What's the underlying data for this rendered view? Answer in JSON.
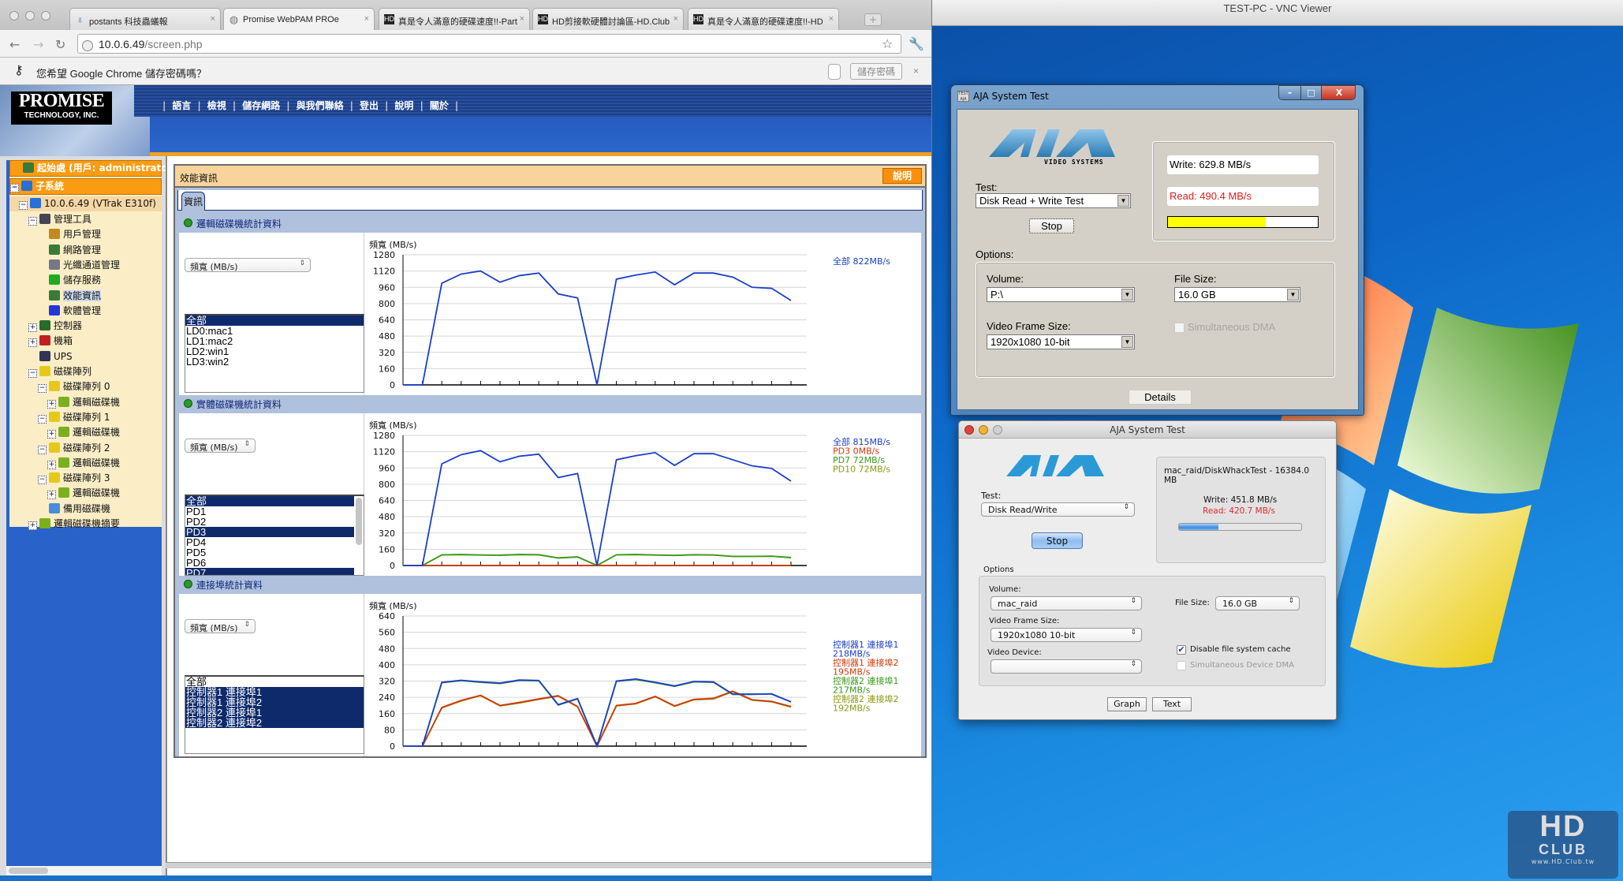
{
  "browser": {
    "tabs": [
      {
        "label": "postants 科技蟲蟻報",
        "favicon": "postants-icon"
      },
      {
        "label": "Promise WebPAM PROe",
        "favicon": "globe-icon",
        "active": true
      },
      {
        "label": "真是令人滿意的硬碟速度!!-Part",
        "favicon": "hd-icon"
      },
      {
        "label": "HD剪接軟硬體討論區-HD.Club",
        "favicon": "hd-icon"
      },
      {
        "label": "真是令人滿意的硬碟速度!!-HD",
        "favicon": "hd-icon"
      }
    ],
    "url_host": "10.0.6.49",
    "url_path": "/screen.php",
    "infobar_message": "您希望 Google Chrome 儲存密碼嗎？",
    "infobar_save": "儲存密碼",
    "infobar_close": "×"
  },
  "promise": {
    "logo_main": "PROMISE",
    "logo_sub": "TECHNOLOGY, INC.",
    "nav": [
      "語言",
      "檢視",
      "儲存網路",
      "與我們聯絡",
      "登出",
      "說明",
      "關於"
    ],
    "tree": [
      {
        "label": "起始處 (用戶: administrator)",
        "level": 0,
        "type": "header",
        "icon": "network-icon"
      },
      {
        "label": "子系統",
        "level": 0,
        "type": "header",
        "icon": "subsystem-icon",
        "toggle": "-"
      },
      {
        "label": "10.0.6.49 (VTrak E310f)",
        "level": 1,
        "type": "sub",
        "icon": "server-icon",
        "toggle": "-"
      },
      {
        "label": "管理工具",
        "level": 2,
        "icon": "admin-tools-icon",
        "toggle": "-"
      },
      {
        "label": "用戶管理",
        "level": 3,
        "icon": "user-icon"
      },
      {
        "label": "網路管理",
        "level": 3,
        "icon": "network-icon"
      },
      {
        "label": "光纖通道管理",
        "level": 3,
        "icon": "fibre-channel-icon"
      },
      {
        "label": "儲存服務",
        "level": 3,
        "icon": "storage-service-icon"
      },
      {
        "label": "效能資訊",
        "level": 3,
        "icon": "network-icon",
        "selected": true
      },
      {
        "label": "軟體管理",
        "level": 3,
        "icon": "software-gear-icon"
      },
      {
        "label": "控制器",
        "level": 2,
        "icon": "controller-icon",
        "toggle": "+"
      },
      {
        "label": "機箱",
        "level": 2,
        "icon": "enclosure-icon",
        "toggle": "+"
      },
      {
        "label": "UPS",
        "level": 2,
        "icon": "ups-icon"
      },
      {
        "label": "磁碟陣列",
        "level": 2,
        "icon": "disk-array-icon",
        "toggle": "-"
      },
      {
        "label": "磁碟陣列 0",
        "level": 3,
        "icon": "disk-array-icon",
        "toggle": "-"
      },
      {
        "label": "邏輯磁碟機",
        "level": 4,
        "icon": "logical-drive-icon",
        "toggle": "+"
      },
      {
        "label": "磁碟陣列 1",
        "level": 3,
        "icon": "disk-array-icon",
        "toggle": "-"
      },
      {
        "label": "邏輯磁碟機",
        "level": 4,
        "icon": "logical-drive-icon",
        "toggle": "+"
      },
      {
        "label": "磁碟陣列 2",
        "level": 3,
        "icon": "disk-array-icon",
        "toggle": "-"
      },
      {
        "label": "邏輯磁碟機",
        "level": 4,
        "icon": "logical-drive-icon",
        "toggle": "+"
      },
      {
        "label": "磁碟陣列 3",
        "level": 3,
        "icon": "disk-array-icon",
        "toggle": "-"
      },
      {
        "label": "邏輯磁碟機",
        "level": 4,
        "icon": "logical-drive-icon",
        "toggle": "+"
      },
      {
        "label": "備用磁碟機",
        "level": 3,
        "icon": "spare-drive-icon"
      },
      {
        "label": "邏輯磁碟機摘要",
        "level": 2,
        "icon": "logical-drive-icon",
        "toggle": "+"
      }
    ],
    "panel_title": "效能資訊",
    "help_label": "說明",
    "tab_label": "資訊",
    "sections": [
      {
        "title": "邏輯磁碟機統計資料",
        "metric_select": "頻寬 (MB/s)",
        "list": [
          {
            "label": "全部",
            "selected": true
          },
          {
            "label": "LD0:mac1"
          },
          {
            "label": "LD1:mac2"
          },
          {
            "label": "LD2:win1"
          },
          {
            "label": "LD3:win2"
          }
        ],
        "list_scroll": false
      },
      {
        "title": "實體磁碟機統計資料",
        "metric_select": "頻寬 (MB/s)",
        "list": [
          {
            "label": "全部",
            "selected": true
          },
          {
            "label": "PD1"
          },
          {
            "label": "PD2"
          },
          {
            "label": "PD3",
            "selected": true
          },
          {
            "label": "PD4"
          },
          {
            "label": "PD5"
          },
          {
            "label": "PD6"
          },
          {
            "label": "PD7",
            "selected": true
          }
        ],
        "list_scroll": true
      },
      {
        "title": "連接埠統計資料",
        "metric_select": "頻寬 (MB/s)",
        "list": [
          {
            "label": "全部"
          },
          {
            "label": "控制器1 連接埠1",
            "selected": true
          },
          {
            "label": "控制器1 連接埠2",
            "selected": true
          },
          {
            "label": "控制器2 連接埠1",
            "selected": true
          },
          {
            "label": "控制器2 連接埠2",
            "selected": true
          }
        ],
        "list_scroll": false
      }
    ]
  },
  "chart_data": [
    {
      "type": "line",
      "title": "邏輯磁碟機統計資料",
      "ylabel": "頻寬 (MB/s)",
      "ylim": [
        0,
        1280
      ],
      "yticks": [
        0,
        160,
        320,
        480,
        640,
        800,
        960,
        1120,
        1280
      ],
      "grid": true,
      "legend_position": "right",
      "series": [
        {
          "name": "全部",
          "legend": "全部 822MB/s",
          "color": "#1a3fcc",
          "values": [
            0,
            0,
            1000,
            1090,
            1120,
            1010,
            1075,
            1100,
            895,
            855,
            0,
            1040,
            1080,
            1110,
            985,
            1100,
            1100,
            1060,
            960,
            950,
            830
          ]
        }
      ]
    },
    {
      "type": "line",
      "title": "實體磁碟機統計資料",
      "ylabel": "頻寬 (MB/s)",
      "ylim": [
        0,
        1280
      ],
      "yticks": [
        0,
        160,
        320,
        480,
        640,
        800,
        960,
        1120,
        1280
      ],
      "grid": true,
      "legend_position": "right",
      "series": [
        {
          "name": "全部",
          "legend": "全部 815MB/s",
          "color": "#1a3fcc",
          "values": [
            0,
            0,
            1000,
            1090,
            1130,
            1020,
            1075,
            1095,
            865,
            905,
            0,
            1040,
            1080,
            1110,
            985,
            1100,
            1100,
            1040,
            980,
            955,
            830
          ]
        },
        {
          "name": "PD3",
          "legend": "PD3 0MB/s",
          "color": "#d03a0a",
          "values": [
            0,
            0,
            0,
            0,
            0,
            0,
            0,
            0,
            0,
            0,
            0,
            0,
            0,
            0,
            0,
            0,
            0,
            0,
            0,
            0,
            0
          ]
        },
        {
          "name": "PD7",
          "legend": "PD7 72MB/s",
          "color": "#3a9a1a",
          "values": [
            0,
            0,
            105,
            108,
            104,
            102,
            108,
            106,
            75,
            85,
            0,
            106,
            108,
            104,
            100,
            106,
            104,
            90,
            90,
            92,
            78
          ]
        },
        {
          "name": "PD10",
          "legend": "PD10 72MB/s",
          "color": "#8a9a10",
          "values": [
            0,
            0,
            104,
            107,
            103,
            101,
            107,
            105,
            74,
            84,
            0,
            105,
            107,
            103,
            99,
            105,
            103,
            89,
            89,
            91,
            77
          ]
        }
      ]
    },
    {
      "type": "line",
      "title": "連接埠統計資料",
      "ylabel": "頻寬 (MB/s)",
      "ylim": [
        0,
        640
      ],
      "yticks": [
        0,
        80,
        160,
        240,
        320,
        400,
        480,
        560,
        640
      ],
      "grid": true,
      "legend_position": "right",
      "series": [
        {
          "name": "控制器1 連接埠1",
          "legend": [
            "控制器1 連接埠1",
            "218MB/s"
          ],
          "color": "#1a3fcc",
          "values": [
            0,
            0,
            314,
            324,
            316,
            310,
            325,
            323,
            204,
            234,
            0,
            320,
            330,
            314,
            296,
            318,
            316,
            256,
            256,
            256,
            218
          ]
        },
        {
          "name": "控制器1 連接埠2",
          "legend": [
            "控制器1 連接埠2",
            "195MB/s"
          ],
          "color": "#d03a0a",
          "values": [
            0,
            0,
            190,
            225,
            250,
            200,
            215,
            232,
            248,
            195,
            0,
            200,
            210,
            245,
            198,
            230,
            235,
            270,
            228,
            220,
            195
          ]
        },
        {
          "name": "控制器2 連接埠1",
          "legend": [
            "控制器2 連接埠1",
            "217MB/s"
          ],
          "color": "#3a9a1a",
          "values": [
            0,
            0,
            312,
            322,
            314,
            308,
            323,
            321,
            202,
            232,
            0,
            318,
            328,
            312,
            294,
            316,
            314,
            254,
            254,
            258,
            217
          ]
        },
        {
          "name": "控制器2 連接埠2",
          "legend": [
            "控制器2 連接埠2",
            "192MB/s"
          ],
          "color": "#8a9a10",
          "values": [
            0,
            0,
            188,
            222,
            248,
            198,
            212,
            230,
            246,
            193,
            0,
            198,
            208,
            243,
            196,
            228,
            232,
            268,
            226,
            218,
            192
          ]
        }
      ]
    }
  ],
  "vnc": {
    "title": "TEST-PC - VNC Viewer"
  },
  "aja_win": {
    "title": "AJA System Test",
    "logo": "AJA",
    "logo_sub": "VIDEO SYSTEMS",
    "test_label": "Test:",
    "test_value": "Disk Read + Write Test",
    "stop_label": "Stop",
    "write": "Write: 629.8 MB/s",
    "read": "Read: 490.4 MB/s",
    "progress": 0.65,
    "options_label": "Options:",
    "volume_label": "Volume:",
    "volume_value": "P:\\",
    "filesize_label": "File Size:",
    "filesize_value": "16.0 GB",
    "frame_label": "Video Frame Size:",
    "frame_value": "1920x1080 10-bit",
    "simdma_label": "Simultaneous DMA",
    "simdma_checked": false,
    "details_label": "Details",
    "progress_color": "#ffff00"
  },
  "aja_mac": {
    "title": "AJA System Test",
    "logo": "AJA",
    "test_label": "Test:",
    "test_value": "Disk Read/Write",
    "stop_label": "Stop",
    "file_info": "mac_raid/DiskWhackTest - 16384.0 MB",
    "write": "Write: 451.8 MB/s",
    "read": "Read: 420.7 MB/s",
    "progress": 0.32,
    "options_label": "Options",
    "volume_label": "Volume:",
    "volume_value": "mac_raid",
    "filesize_label": "File Size:",
    "filesize_value": "16.0 GB",
    "frame_label": "Video Frame Size:",
    "frame_value": "1920x1080 10-bit",
    "device_label": "Video Device:",
    "device_value": "",
    "disable_cache_label": "Disable file system cache",
    "disable_cache_checked": true,
    "simdma_label": "Simultaneous Device DMA",
    "simdma_checked": false,
    "graph_label": "Graph",
    "text_label": "Text"
  },
  "watermark": {
    "big": "HD",
    "club": "CLUB",
    "url": "www.HD.Club.tw"
  }
}
